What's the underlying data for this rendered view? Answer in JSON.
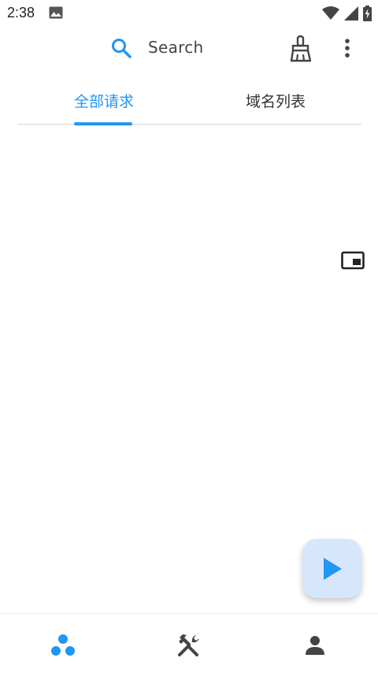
{
  "status_bar": {
    "time": "2:38",
    "icons": [
      "image-icon",
      "wifi-icon",
      "signal-icon",
      "battery-charging-icon"
    ]
  },
  "search": {
    "label": "Search",
    "icon": "search-icon"
  },
  "toolbar": {
    "clear_icon": "broom-icon",
    "more_icon": "more-vertical-icon"
  },
  "tabs": [
    {
      "label": "全部请求",
      "selected": true
    },
    {
      "label": "域名列表",
      "selected": false
    }
  ],
  "floating": {
    "pip_icon": "picture-in-picture-icon",
    "fab_icon": "play-icon"
  },
  "bottom_nav": [
    {
      "icon": "requests-dots-icon",
      "active": true
    },
    {
      "icon": "tools-icon",
      "active": false
    },
    {
      "icon": "person-icon",
      "active": false
    }
  ],
  "colors": {
    "accent": "#2196f3",
    "fab_bg": "#d6e7fb",
    "text": "#333333",
    "icon_gray": "#444444"
  }
}
